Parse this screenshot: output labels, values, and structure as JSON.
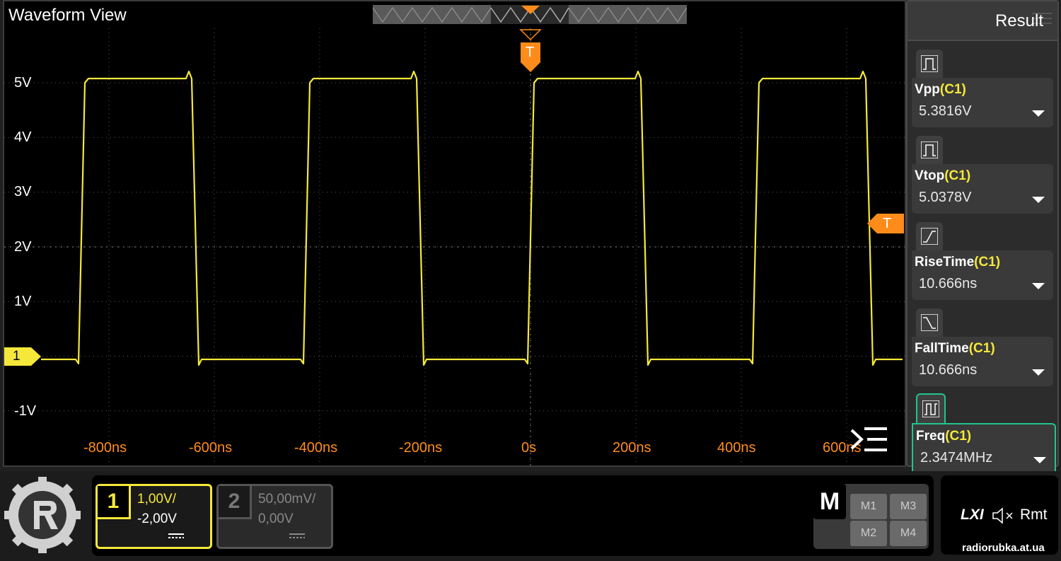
{
  "waveform": {
    "title": "Waveform View",
    "y_labels": [
      "5V",
      "4V",
      "3V",
      "2V",
      "1V",
      "-1V"
    ],
    "x_labels": [
      "-800ns",
      "-600ns",
      "-400ns",
      "-200ns",
      "0s",
      "200ns",
      "400ns",
      "600ns"
    ],
    "channel_marker": "1",
    "trigger_marker_top": "T",
    "trigger_marker_right": "T",
    "colors": {
      "trace": "#f5e83a",
      "trigger": "#ff8c1a",
      "grid": "#5a5a5a",
      "background": "#000000"
    }
  },
  "result_panel": {
    "title": "Result",
    "measurements": [
      {
        "name": "Vpp",
        "channel": "(C1)",
        "value": "5.3816V",
        "icon": "pulse-width-icon"
      },
      {
        "name": "Vtop",
        "channel": "(C1)",
        "value": "5.0378V",
        "icon": "pulse-width-icon"
      },
      {
        "name": "RiseTime",
        "channel": "(C1)",
        "value": "10.666ns",
        "icon": "rise-edge-icon"
      },
      {
        "name": "FallTime",
        "channel": "(C1)",
        "value": "10.666ns",
        "icon": "fall-edge-icon"
      },
      {
        "name": "Freq",
        "channel": "(C1)",
        "value": "2.3474MHz",
        "icon": "period-icon",
        "active": true
      }
    ]
  },
  "channels": [
    {
      "num": "1",
      "scale": "1,00V/",
      "offset": "-2,00V",
      "active": true
    },
    {
      "num": "2",
      "scale": "50,00mV/",
      "offset": "0,00V",
      "active": false
    }
  ],
  "math": {
    "label": "M",
    "buttons": [
      "M1",
      "M3",
      "M2",
      "M4"
    ]
  },
  "status": {
    "lxi": "LXI",
    "rmt": "Rmt",
    "mute_icon": "speaker-mute-icon"
  },
  "watermark": "radiorubka.at.ua"
}
